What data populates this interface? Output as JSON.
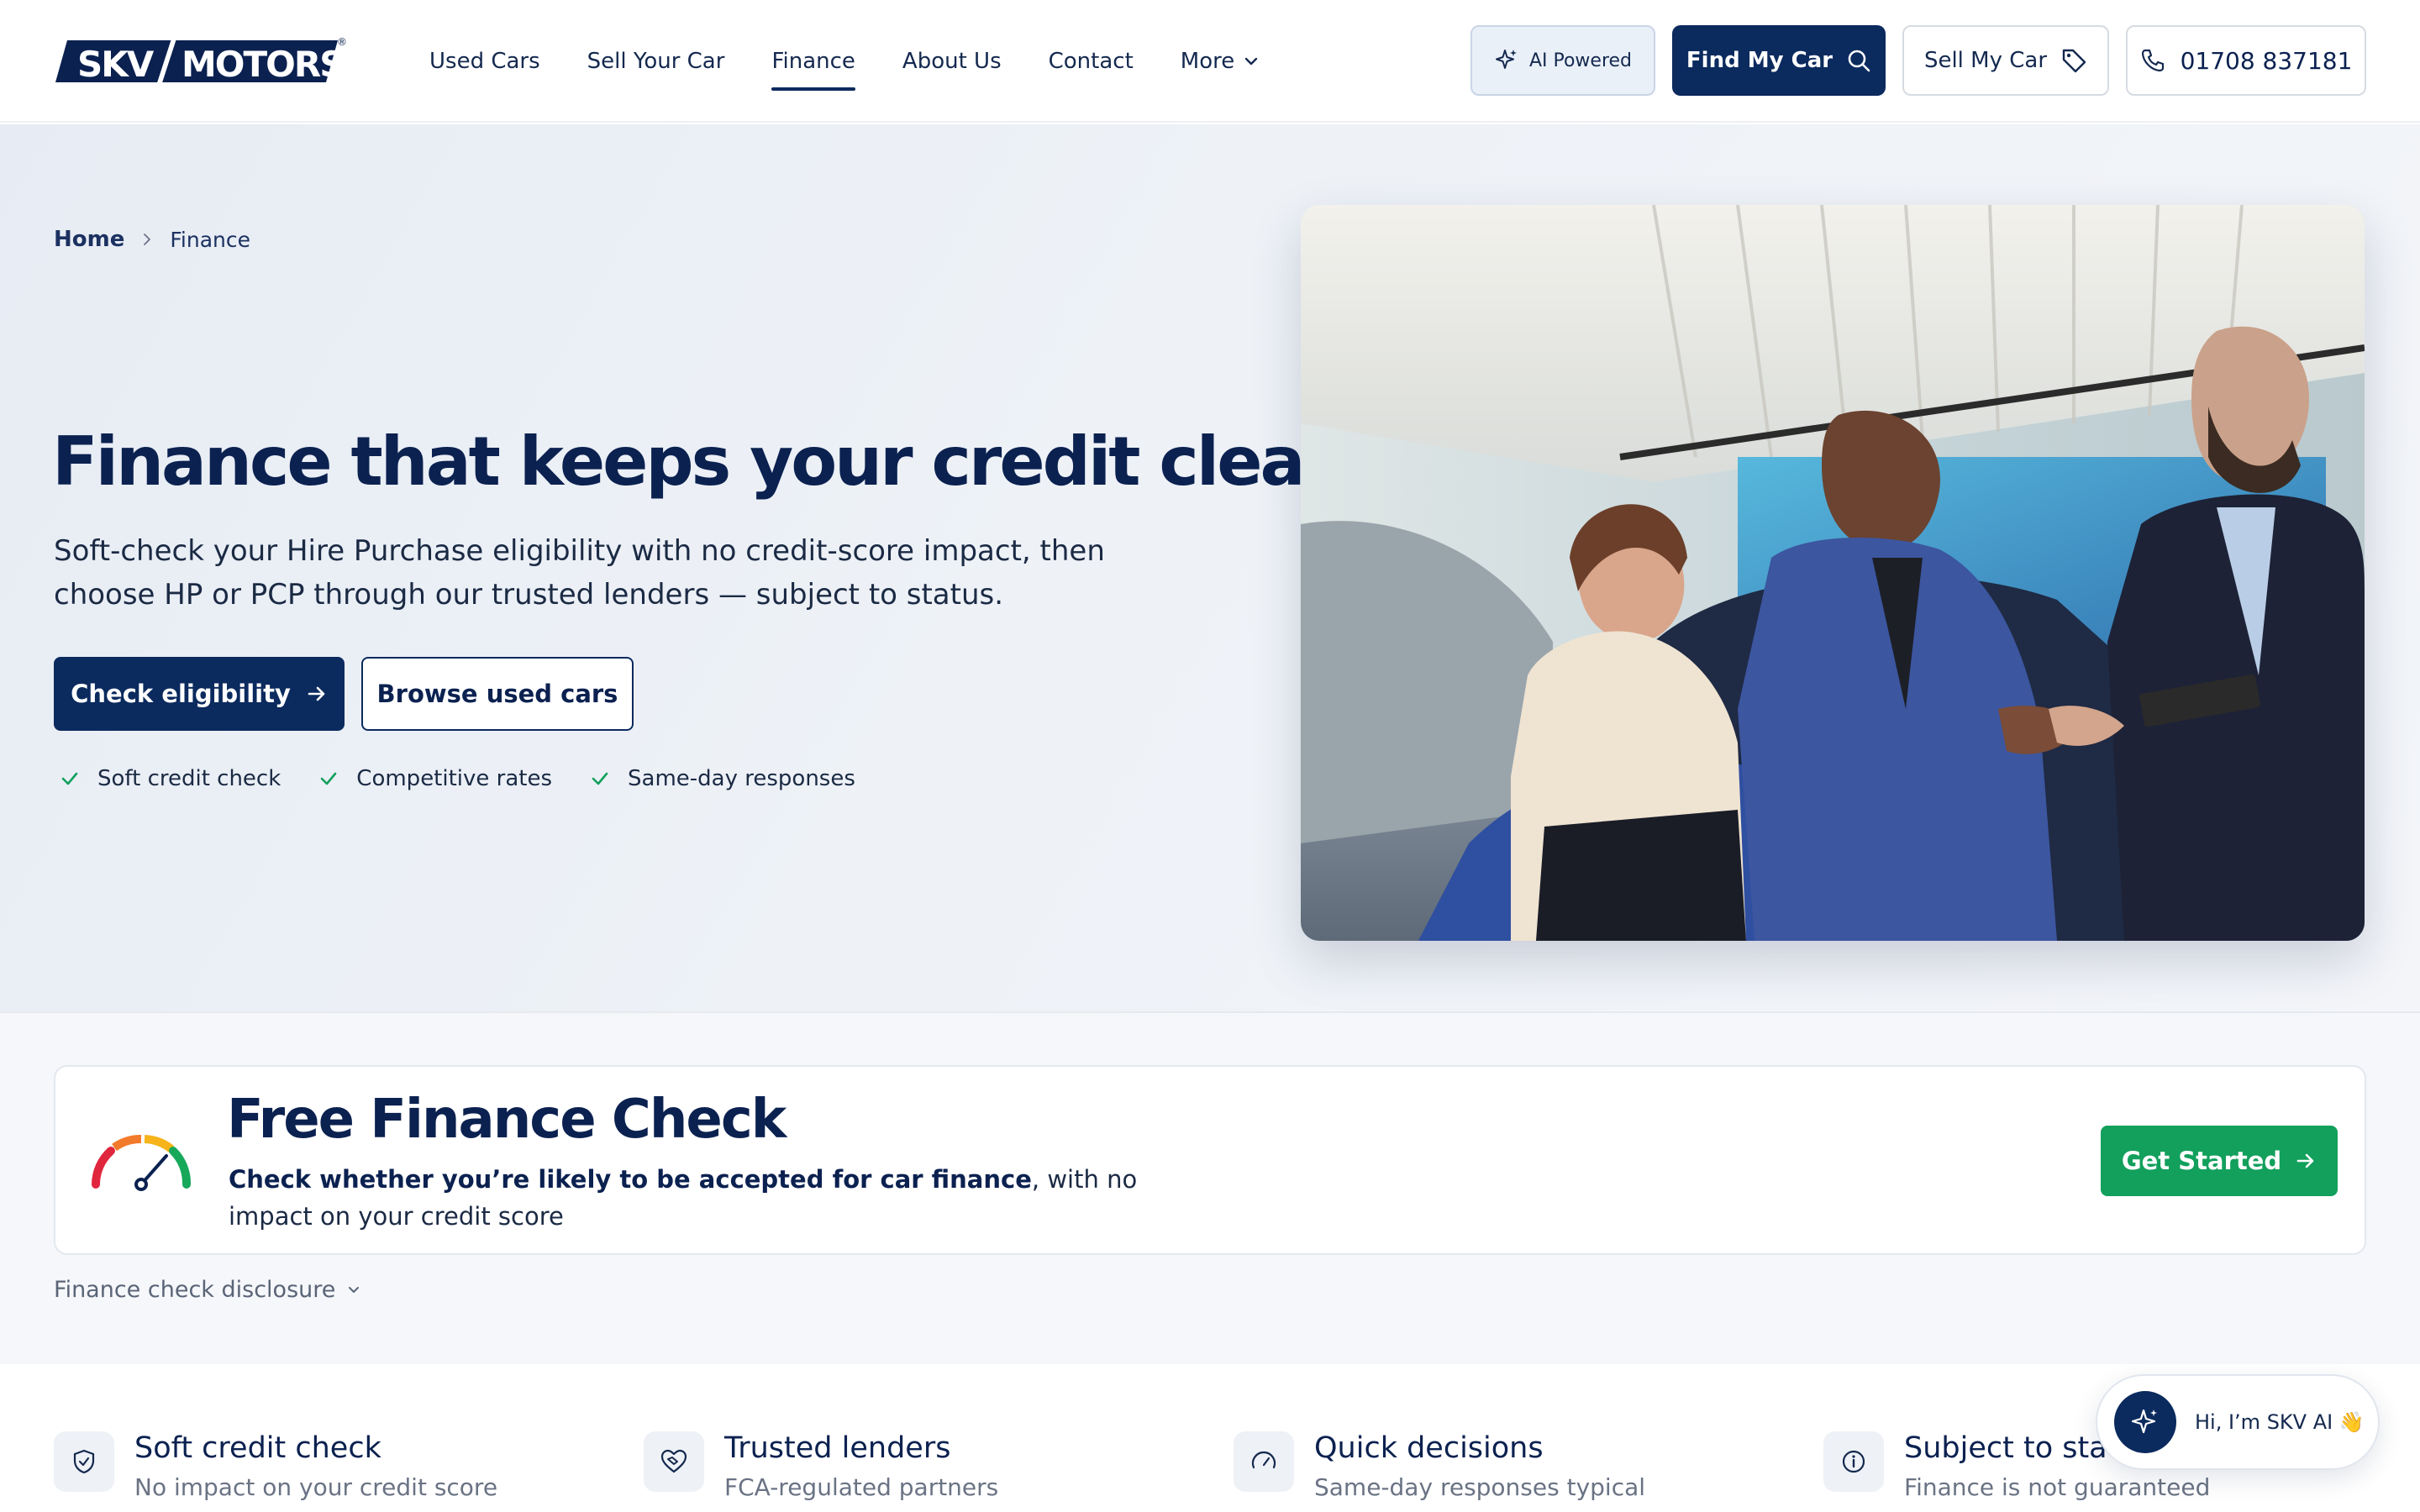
{
  "brand": {
    "logo_left": "SKV",
    "logo_right": "MOTORS",
    "logo_mark": "®",
    "primary_color": "#0b2a5e",
    "accent_green": "#12a05c"
  },
  "nav": {
    "items": [
      {
        "label": "Used Cars",
        "active": false
      },
      {
        "label": "Sell Your Car",
        "active": false
      },
      {
        "label": "Finance",
        "active": true
      },
      {
        "label": "About Us",
        "active": false
      },
      {
        "label": "Contact",
        "active": false
      },
      {
        "label": "More",
        "active": false,
        "icon": "chevron-down-icon"
      }
    ]
  },
  "header_actions": {
    "ai_label": "AI Powered",
    "find_label": "Find My Car",
    "sell_label": "Sell My Car",
    "phone": "01708 837181"
  },
  "breadcrumb": {
    "home": "Home",
    "current": "Finance"
  },
  "hero": {
    "title": "Finance that keeps your credit clear",
    "subtitle": "Soft-check your Hire Purchase eligibility with no credit-score impact, then choose HP or PCP through our trusted lenders — subject to status.",
    "primary_cta": "Check eligibility",
    "secondary_cta": "Browse used cars",
    "ticks": [
      "Soft credit check",
      "Competitive rates",
      "Same-day responses"
    ]
  },
  "finance_check": {
    "title": "Free Finance Check",
    "desc_bold": "Check whether you’re likely to be accepted for car finance",
    "desc_rest": ", with no impact on your credit score",
    "button": "Get Started",
    "disclosure": "Finance check disclosure"
  },
  "features": [
    {
      "icon": "shield-icon",
      "title": "Soft credit check",
      "sub": "No impact on your credit score"
    },
    {
      "icon": "heart-handshake-icon",
      "title": "Trusted lenders",
      "sub": "FCA-regulated partners"
    },
    {
      "icon": "gauge-icon",
      "title": "Quick decisions",
      "sub": "Same-day responses typical"
    },
    {
      "icon": "info-icon",
      "title": "Subject to status",
      "sub": "Finance is not guaranteed"
    }
  ],
  "chat": {
    "text": "Hi, I’m SKV AI 👋"
  }
}
